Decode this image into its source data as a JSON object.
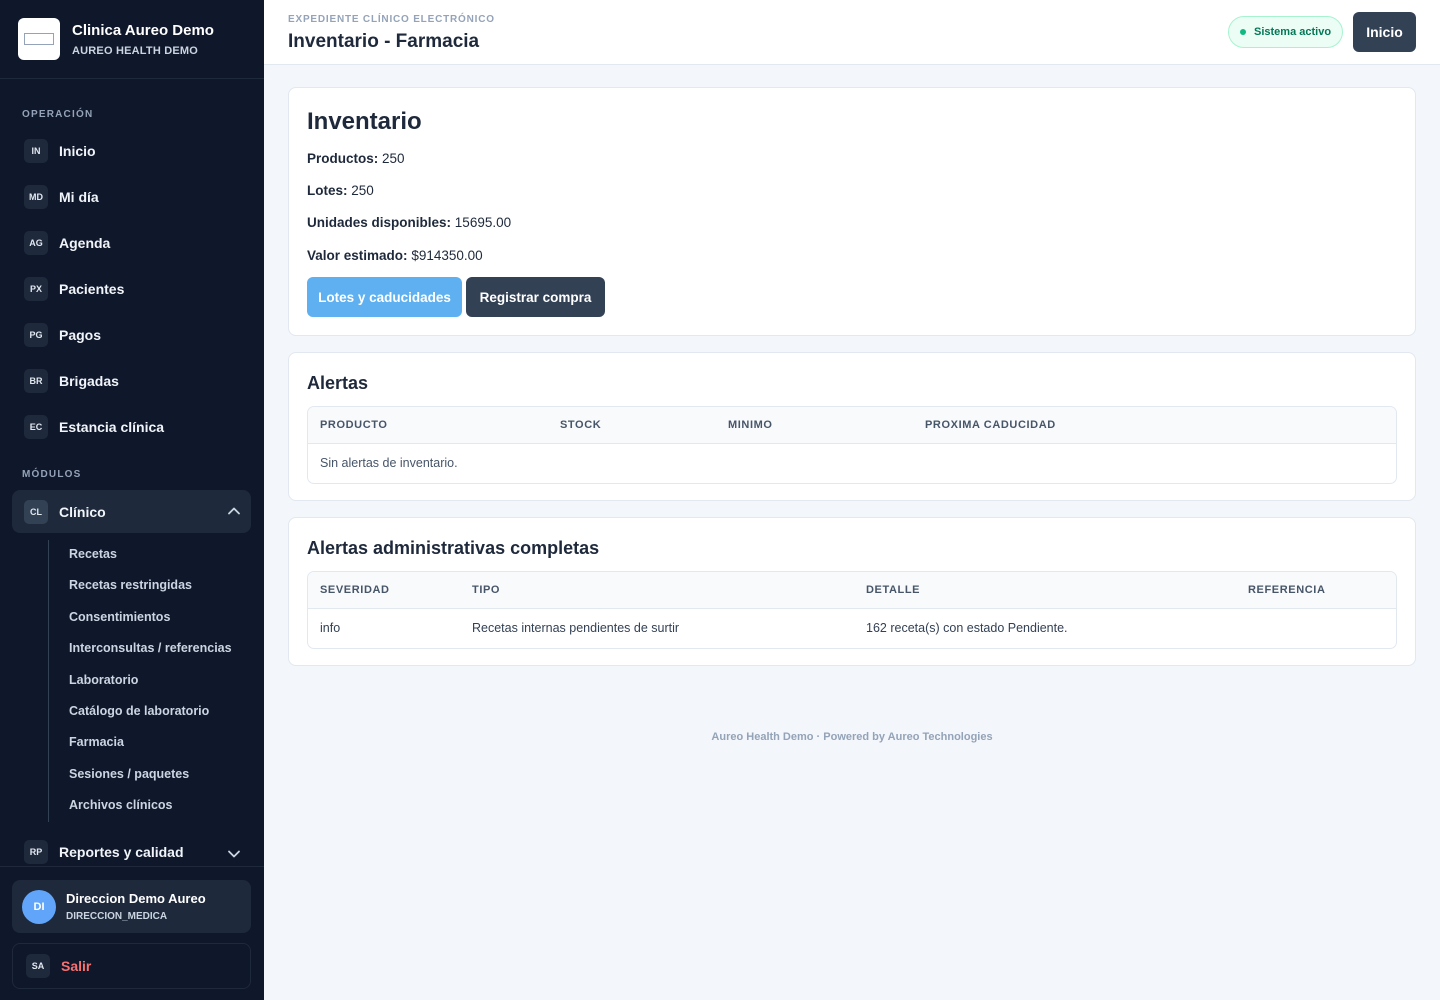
{
  "brand": {
    "name": "Clinica Aureo Demo",
    "subtitle": "AUREO HEALTH DEMO"
  },
  "sidebar": {
    "section_operation": "OPERACIÓN",
    "operation_items": [
      {
        "code": "IN",
        "label": "Inicio"
      },
      {
        "code": "MD",
        "label": "Mi día"
      },
      {
        "code": "AG",
        "label": "Agenda"
      },
      {
        "code": "PX",
        "label": "Pacientes"
      },
      {
        "code": "PG",
        "label": "Pagos"
      },
      {
        "code": "BR",
        "label": "Brigadas"
      },
      {
        "code": "EC",
        "label": "Estancia clínica"
      }
    ],
    "section_modules": "MÓDULOS",
    "clinical": {
      "code": "CL",
      "label": "Clínico",
      "icon": "chevron-up-icon"
    },
    "clinical_sub": [
      "Recetas",
      "Recetas restringidas",
      "Consentimientos",
      "Interconsultas / referencias",
      "Laboratorio",
      "Catálogo de laboratorio",
      "Farmacia",
      "Sesiones / paquetes",
      "Archivos clínicos"
    ],
    "reports": {
      "code": "RP",
      "label": "Reportes y calidad",
      "icon": "chevron-down-icon"
    },
    "user": {
      "initials": "DI",
      "name": "Direccion Demo Aureo",
      "role": "DIRECCION_MEDICA"
    },
    "logout": {
      "code": "SA",
      "label": "Salir"
    }
  },
  "header": {
    "eyebrow": "EXPEDIENTE CLÍNICO ELECTRÓNICO",
    "title": "Inventario - Farmacia",
    "status": "Sistema activo",
    "home_button": "Inicio"
  },
  "inventory": {
    "title": "Inventario",
    "stats": [
      {
        "label": "Productos:",
        "value": "250"
      },
      {
        "label": "Lotes:",
        "value": "250"
      },
      {
        "label": "Unidades disponibles:",
        "value": "15695.00"
      },
      {
        "label": "Valor estimado:",
        "value": "$914350.00"
      }
    ],
    "buttons": {
      "lots": "Lotes y caducidades",
      "purchase": "Registrar compra"
    }
  },
  "alerts": {
    "title": "Alertas",
    "columns": [
      "PRODUCTO",
      "STOCK",
      "MINIMO",
      "PROXIMA CADUCIDAD"
    ],
    "empty": "Sin alertas de inventario."
  },
  "admin_alerts": {
    "title": "Alertas administrativas completas",
    "columns": [
      "SEVERIDAD",
      "TIPO",
      "DETALLE",
      "REFERENCIA"
    ],
    "rows": [
      {
        "severity": "info",
        "type": "Recetas internas pendientes de surtir",
        "detail": "162 receta(s) con estado Pendiente.",
        "reference": ""
      }
    ]
  },
  "footer": {
    "text": "Aureo Health Demo · Powered by Aureo Technologies"
  },
  "colors": {
    "sidebar_bg": "#0f172a",
    "accent_blue": "#5eb0f0",
    "dark_button": "#334155",
    "status_green": "#10b981",
    "logout_red": "#f87171"
  }
}
